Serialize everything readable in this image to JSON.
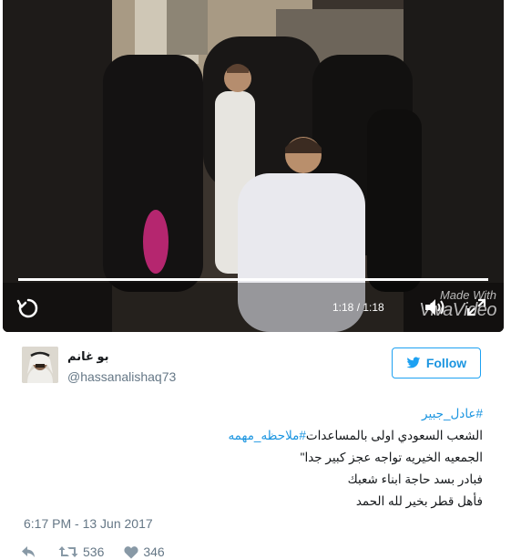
{
  "video": {
    "time_text": "1:18 / 1:18",
    "progress": 1.0,
    "watermark_line1": "Made With",
    "watermark_line2": "VivaVideo"
  },
  "user": {
    "display_name": "بو غانم",
    "handle": "@hassanalishaq73"
  },
  "follow_button": {
    "label": "Follow"
  },
  "tweet": {
    "line1_hashtag": "#عادل_جبير",
    "line2_text": "الشعب السعودي اولى بالمساعدات",
    "line2_hashtag": "#ملاحظه_مهمه",
    "line3": "الجمعيه الخيريه تواجه عجز كبير جدا\"",
    "line4": "فبادر بسد حاجة ابناء شعبك",
    "line5": "فأهل قطر بخير لله الحمد"
  },
  "timestamp": "6:17 PM - 13 Jun 2017",
  "actions": {
    "retweet_count": "536",
    "like_count": "346"
  },
  "colors": {
    "accent": "#1da1f2",
    "link": "#1b95e0",
    "muted": "#657786"
  }
}
